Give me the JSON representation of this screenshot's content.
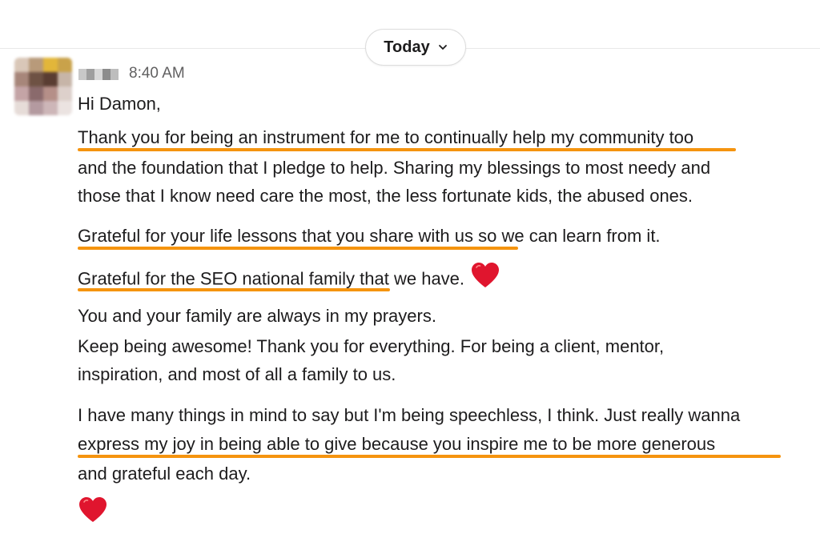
{
  "date_divider": {
    "label": "Today",
    "icon": "chevron-down-icon"
  },
  "message": {
    "sender_name": "",
    "timestamp": "8:40 AM",
    "greeting": "Hi Damon,",
    "lines": [
      "Thank you for being an instrument for me to continually help my community too",
      "and the foundation that I pledge to help. Sharing my blessings to most needy and",
      "those that I know need care the most, the less fortunate kids, the abused ones.",
      "Grateful for your life lessons that you share with us so we can learn from it.",
      "Grateful for the SEO national family that we have.",
      "You and your family are always in my prayers.",
      "Keep being awesome! Thank you for everything. For being a client, mentor,",
      "inspiration, and most of all a family to us.",
      "I have many things in mind to say but I'm being speechless, I think. Just really wanna",
      "express my joy in being able to give because you inspire me to be more generous",
      "and grateful each day."
    ],
    "emoji": [
      "heart-emoji",
      "heart-emoji"
    ]
  },
  "colors": {
    "highlight_underline": "#f5940f",
    "heart": "#e0152e",
    "timestamp": "#616061"
  }
}
